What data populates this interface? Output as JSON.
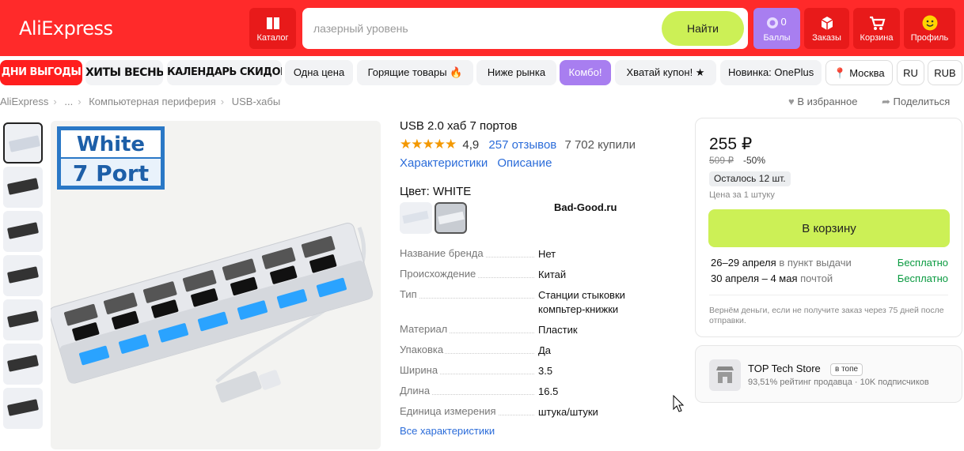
{
  "header": {
    "logo": "AliExpress",
    "catalog": "Каталог",
    "search_placeholder": "лазерный уровень",
    "find": "Найти",
    "points_label": "Баллы",
    "points_count": "0",
    "orders": "Заказы",
    "cart": "Корзина",
    "profile": "Профиль"
  },
  "catbar": {
    "items": [
      "ДНИ ВЫГОДЫ",
      "ХИТЫ ВЕСНЫ",
      "КАЛЕНДАРЬ СКИДОК",
      "Одна цена",
      "Горящие товары 🔥",
      "Ниже рынка",
      "Комбо!",
      "Хватай купон! ★",
      "Новинка: OnePlus"
    ],
    "city": "Москва",
    "lang": "RU",
    "currency": "RUB"
  },
  "breadcrumb": [
    "AliExpress",
    "...",
    "Компьютерная периферия",
    "USB-хабы"
  ],
  "favorite": "В избранное",
  "share": "Поделиться",
  "image_badge": {
    "line1": "White",
    "line2": "7 Port"
  },
  "product": {
    "title": "USB 2.0 хаб 7 портов",
    "stars": "★★★★★",
    "rating": "4,9",
    "reviews": "257 отзывов",
    "sold": "7 702 купили",
    "link_specs": "Характеристики",
    "link_desc": "Описание",
    "color_label": "Цвет: WHITE",
    "watermark": "Bad-Good.ru",
    "specs": [
      {
        "k": "Название бренда",
        "v": "Нет"
      },
      {
        "k": "Происхождение",
        "v": "Китай"
      },
      {
        "k": "Тип",
        "v": "Станции стыковки компьтер-книжки"
      },
      {
        "k": "Материал",
        "v": "Пластик"
      },
      {
        "k": "Упаковка",
        "v": "Да"
      },
      {
        "k": "Ширина",
        "v": "3.5"
      },
      {
        "k": "Длина",
        "v": "16.5"
      },
      {
        "k": "Единица измерения",
        "v": "штука/штуки"
      }
    ],
    "all_specs": "Все характеристики"
  },
  "buy": {
    "price": "255 ₽",
    "old_price": "509 ₽",
    "discount": "-50%",
    "stock": "Осталось 12 шт.",
    "unit": "Цена за 1 штуку",
    "cart_button": "В корзину",
    "delivery1_date": "26–29 апреля",
    "delivery1_how": "в пункт выдачи",
    "delivery1_price": "Бесплатно",
    "delivery2_date": "30 апреля – 4 мая",
    "delivery2_how": "почтой",
    "delivery2_price": "Бесплатно",
    "refund": "Вернём деньги, если не получите заказ через 75 дней после отправки."
  },
  "seller": {
    "name": "TOP Tech Store",
    "badge": "в топе",
    "stats": "93,51% рейтинг продавца · 10K подписчиков"
  }
}
